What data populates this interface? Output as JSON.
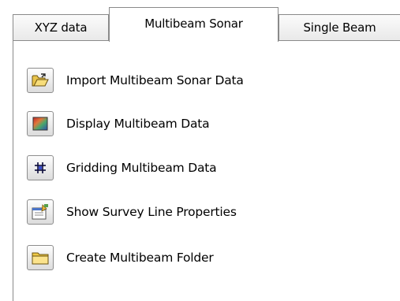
{
  "tabs": [
    {
      "label": "XYZ data",
      "selected": false
    },
    {
      "label": "Multibeam Sonar",
      "selected": true
    },
    {
      "label": "Single Beam",
      "selected": false
    }
  ],
  "commands": [
    {
      "label": "Import Multibeam Sonar Data",
      "icon": "open-folder-icon"
    },
    {
      "label": "Display Multibeam Data",
      "icon": "gradient-display-icon"
    },
    {
      "label": "Gridding Multibeam Data",
      "icon": "grid-icon"
    },
    {
      "label": "Show Survey Line Properties",
      "icon": "properties-icon"
    },
    {
      "label": "Create Multibeam Folder",
      "icon": "folder-icon"
    }
  ]
}
